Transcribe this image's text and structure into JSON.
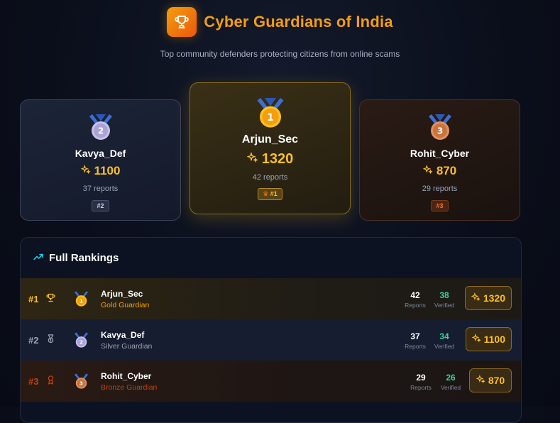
{
  "header": {
    "title": "Cyber Guardians of India",
    "subtitle": "Top community defenders protecting citizens from online scams"
  },
  "podium": [
    {
      "place": "2",
      "name": "Kavya_Def",
      "points": "1100",
      "reports": "37 reports",
      "badge": "#2"
    },
    {
      "place": "1",
      "name": "Arjun_Sec",
      "points": "1320",
      "reports": "42 reports",
      "badge": "#1",
      "badge_icon": "crown-icon"
    },
    {
      "place": "3",
      "name": "Rohit_Cyber",
      "points": "870",
      "reports": "29 reports",
      "badge": "#3"
    }
  ],
  "rankings": {
    "title": "Full Rankings",
    "rows": [
      {
        "rank": "#1",
        "name": "Arjun_Sec",
        "tier": "Gold Guardian",
        "medal": "1",
        "reports": "42",
        "reports_label": "Reports",
        "verified": "38",
        "verified_label": "Verified",
        "points": "1320",
        "icon": "trophy-icon"
      },
      {
        "rank": "#2",
        "name": "Kavya_Def",
        "tier": "Silver Guardian",
        "medal": "2",
        "reports": "37",
        "reports_label": "Reports",
        "verified": "34",
        "verified_label": "Verified",
        "points": "1100",
        "icon": "medal-icon"
      },
      {
        "rank": "#3",
        "name": "Rohit_Cyber",
        "tier": "Bronze Guardian",
        "medal": "3",
        "reports": "29",
        "reports_label": "Reports",
        "verified": "26",
        "verified_label": "Verified",
        "points": "870",
        "icon": "award-icon"
      }
    ]
  },
  "colors": {
    "accent": "#f59e0b",
    "gold": "#fbbf24",
    "silver": "#9ca3af",
    "bronze": "#c2410c",
    "verified": "#34d399",
    "ribbon": "#3b6fd8"
  }
}
